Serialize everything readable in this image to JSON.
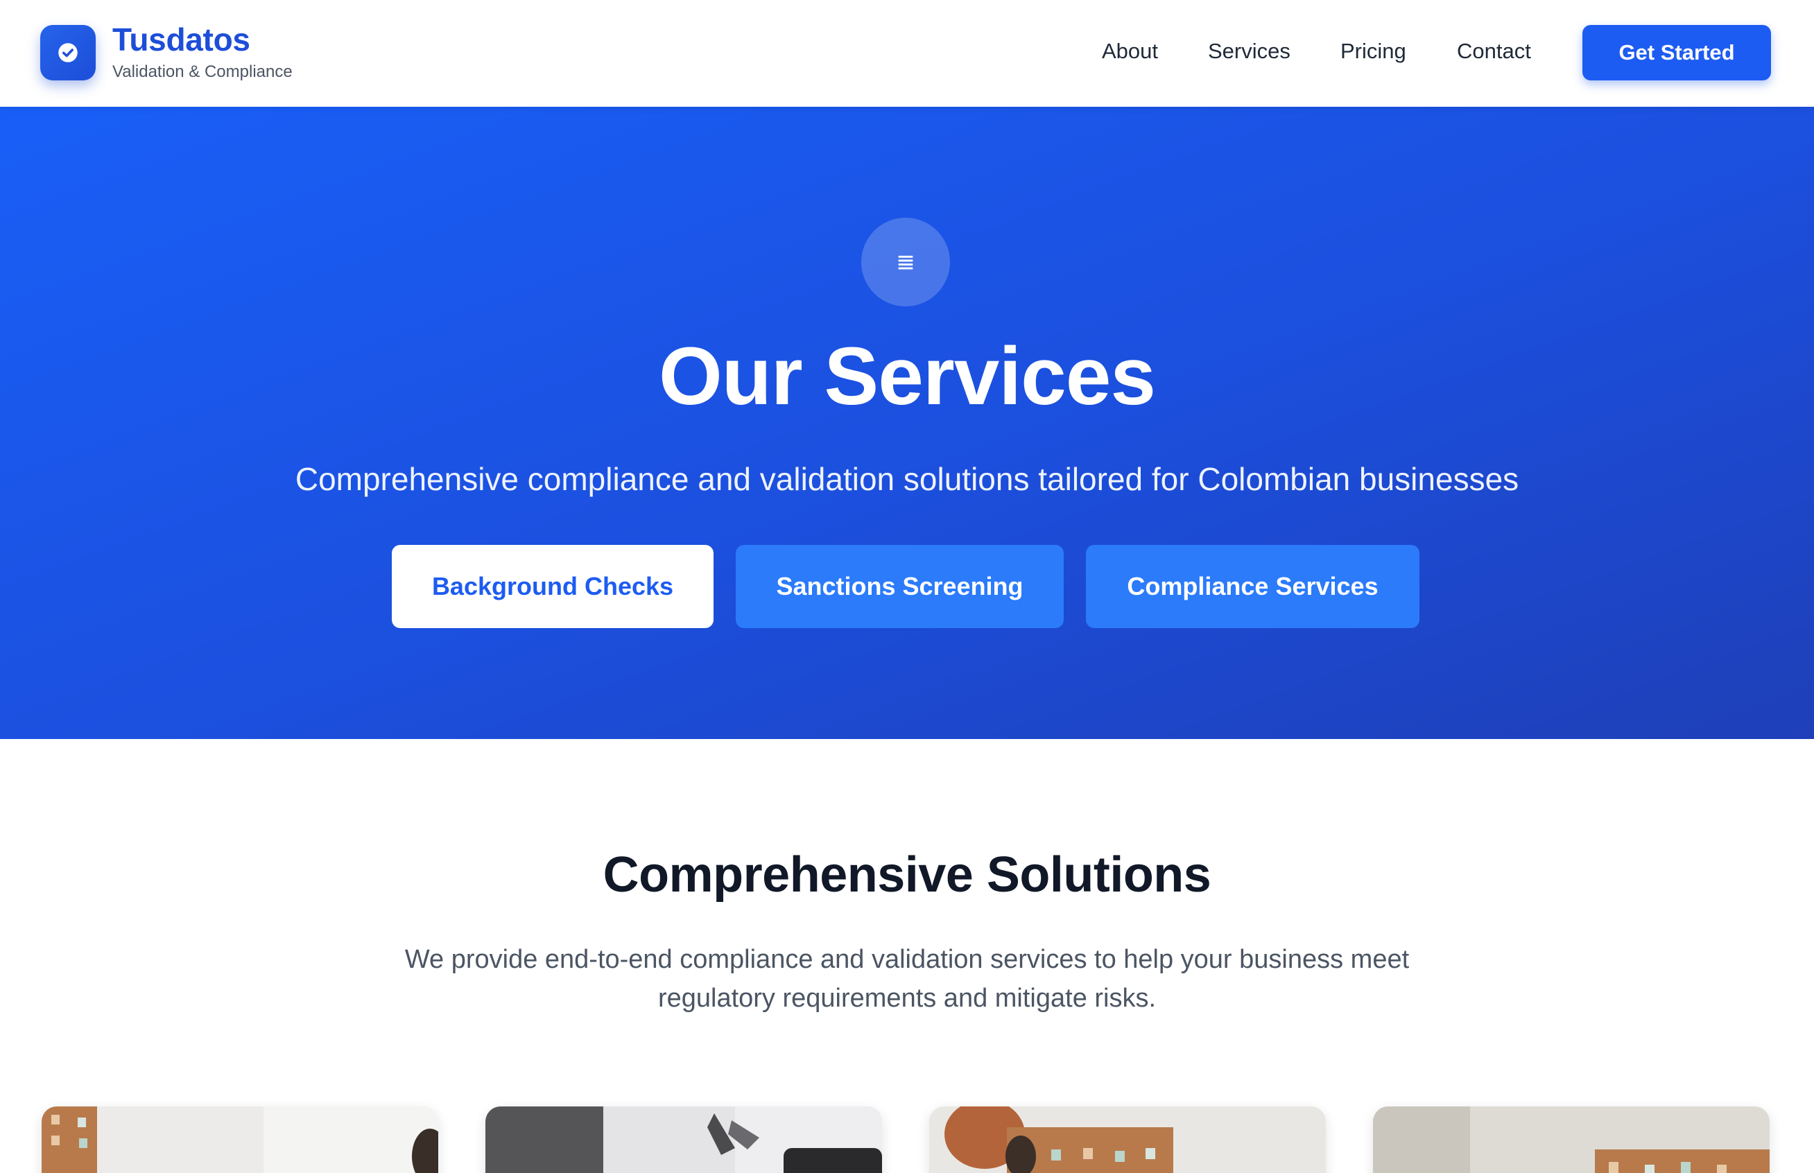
{
  "brand": {
    "name": "Tusdatos",
    "tagline": "Validation & Compliance",
    "logo_icon": "check-badge-icon"
  },
  "nav": {
    "about": "About",
    "services": "Services",
    "pricing": "Pricing",
    "contact": "Contact",
    "cta": "Get Started"
  },
  "hero": {
    "icon": "list-icon",
    "title": "Our Services",
    "subtitle": "Comprehensive compliance and validation solutions tailored for Colombian businesses",
    "buttons": {
      "background_checks": "Background Checks",
      "sanctions_screening": "Sanctions Screening",
      "compliance_services": "Compliance Services"
    }
  },
  "solutions": {
    "title": "Comprehensive Solutions",
    "description": "We provide end-to-end compliance and validation services to help your business meet regulatory requirements and mitigate risks."
  },
  "colors": {
    "primary": "#1d5cf2",
    "brand_text": "#1d4ed8",
    "hero_gradient_start": "#195ff7",
    "hero_gradient_end": "#1e3fb8",
    "secondary_button": "#2b7bfb",
    "heading": "#111827",
    "body_text": "#4b5563"
  }
}
